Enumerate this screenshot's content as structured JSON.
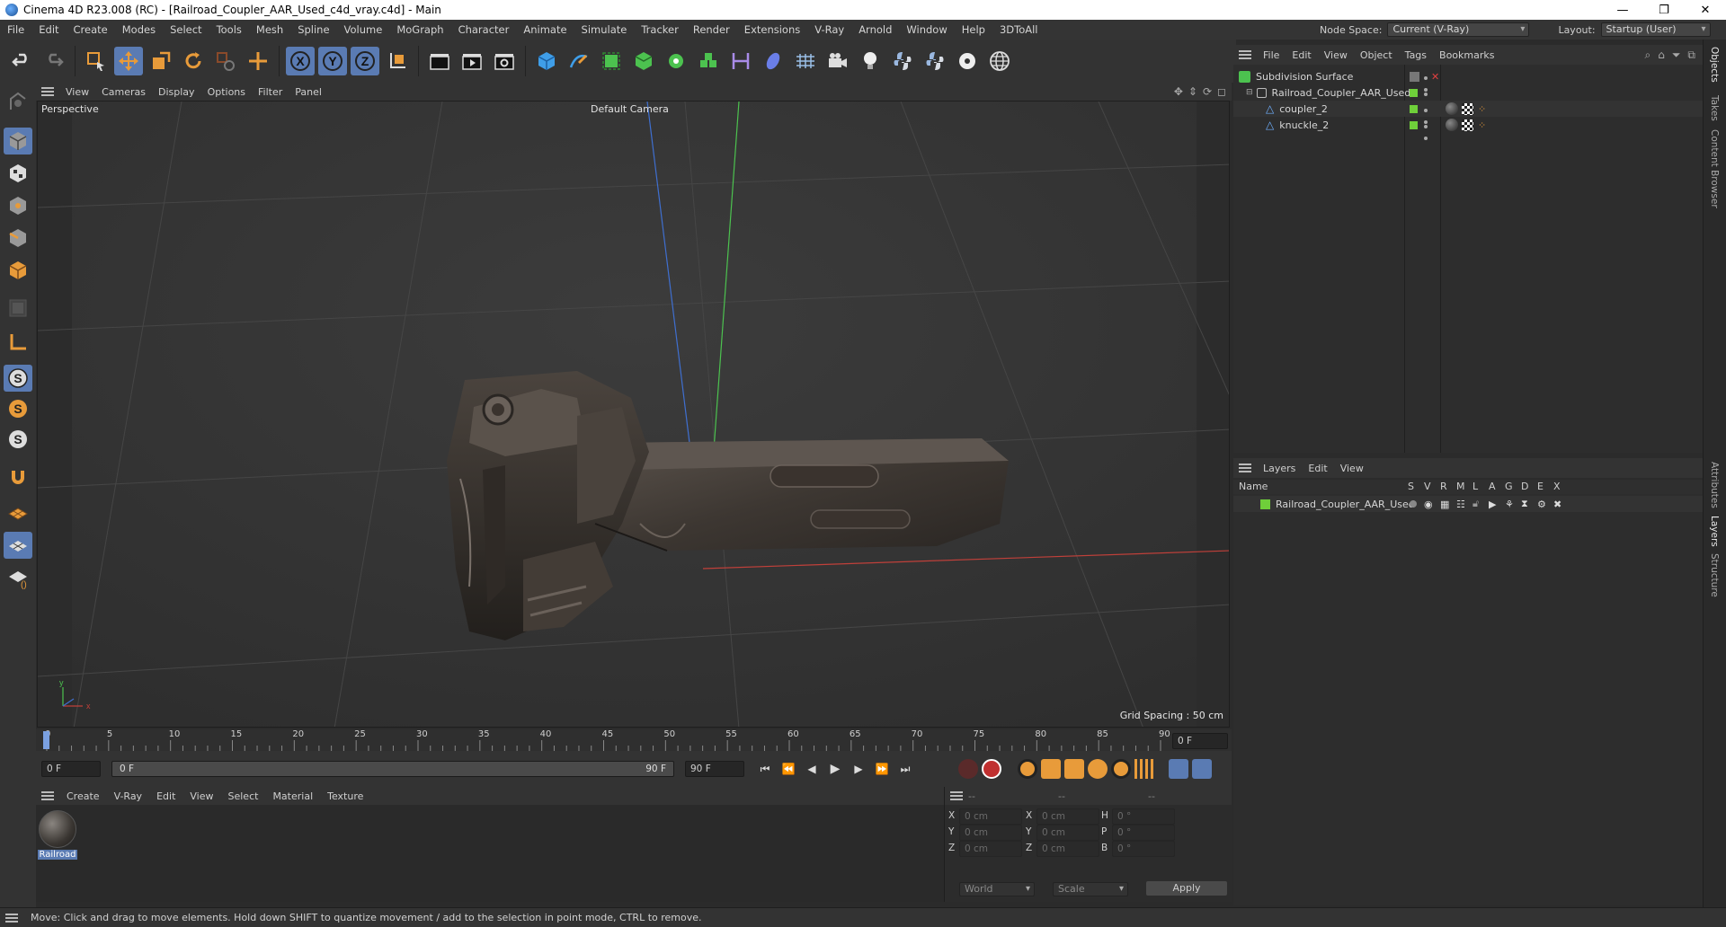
{
  "window": {
    "title": "Cinema 4D R23.008 (RC) - [Railroad_Coupler_AAR_Used_c4d_vray.c4d] - Main",
    "minimize": "—",
    "maximize": "❐",
    "close": "✕"
  },
  "menubar": {
    "items": [
      "File",
      "Edit",
      "Create",
      "Modes",
      "Select",
      "Tools",
      "Mesh",
      "Spline",
      "Volume",
      "MoGraph",
      "Character",
      "Animate",
      "Simulate",
      "Tracker",
      "Render",
      "Extensions",
      "V-Ray",
      "Arnold",
      "Window",
      "Help",
      "3DToAll"
    ],
    "node_space_label": "Node Space:",
    "node_space_value": "Current (V-Ray)",
    "layout_label": "Layout:",
    "layout_value": "Startup (User)"
  },
  "toolbar": {
    "axis_x": "X",
    "axis_y": "Y",
    "axis_z": "Z"
  },
  "viewport": {
    "menu": [
      "View",
      "Cameras",
      "Display",
      "Options",
      "Filter",
      "Panel"
    ],
    "view_name": "Perspective",
    "camera_name": "Default Camera",
    "grid_spacing": "Grid Spacing : 50 cm",
    "axis_y_label": "y",
    "axis_x_label": "x"
  },
  "timeline": {
    "ticks": [
      "0",
      "5",
      "10",
      "15",
      "20",
      "25",
      "30",
      "35",
      "40",
      "45",
      "50",
      "55",
      "60",
      "65",
      "70",
      "75",
      "80",
      "85",
      "90"
    ],
    "current_frame": "0 F",
    "start_frame": "0 F",
    "range_start": "0 F",
    "range_end": "90 F",
    "end_frame": "90 F"
  },
  "material_manager": {
    "menu": [
      "Create",
      "V-Ray",
      "Edit",
      "View",
      "Select",
      "Material",
      "Texture"
    ],
    "materials": [
      {
        "name": "Railroad"
      }
    ]
  },
  "coordinates": {
    "header": [
      "--",
      "--",
      "--"
    ],
    "rows": [
      {
        "a": "X",
        "av": "0 cm",
        "b": "X",
        "bv": "0 cm",
        "c": "H",
        "cv": "0 °"
      },
      {
        "a": "Y",
        "av": "0 cm",
        "b": "Y",
        "bv": "0 cm",
        "c": "P",
        "cv": "0 °"
      },
      {
        "a": "Z",
        "av": "0 cm",
        "b": "Z",
        "bv": "0 cm",
        "c": "B",
        "cv": "0 °"
      }
    ],
    "space": "World",
    "mode": "Scale",
    "apply": "Apply"
  },
  "object_manager": {
    "menu": [
      "File",
      "Edit",
      "View",
      "Object",
      "Tags",
      "Bookmarks"
    ],
    "objects": [
      {
        "name": "Subdivision Surface",
        "level": 0
      },
      {
        "name": "Railroad_Coupler_AAR_Used",
        "level": 1
      },
      {
        "name": "coupler_2",
        "level": 2
      },
      {
        "name": "knuckle_2",
        "level": 2
      }
    ]
  },
  "layer_manager": {
    "menu": [
      "Layers",
      "Edit",
      "View"
    ],
    "columns": [
      "Name",
      "S",
      "V",
      "R",
      "M",
      "L",
      "A",
      "G",
      "D",
      "E",
      "X"
    ],
    "layers": [
      {
        "name": "Railroad_Coupler_AAR_Used",
        "color": "#6fcf3a"
      }
    ]
  },
  "side_tabs": [
    "Objects",
    "Takes",
    "Content Browser",
    "Attributes",
    "Layers",
    "Structure"
  ],
  "status": {
    "text": "Move: Click and drag to move elements. Hold down SHIFT to quantize movement / add to the selection in point mode, CTRL to remove."
  },
  "colors": {
    "accent": "#5a7bb3",
    "layer_green": "#6fcf3a",
    "axis_x": "#c0403a",
    "axis_y": "#4cc24f",
    "axis_z": "#3f6fd0",
    "icon_orange": "#e89b3a",
    "icon_blue": "#3f9ee8"
  }
}
